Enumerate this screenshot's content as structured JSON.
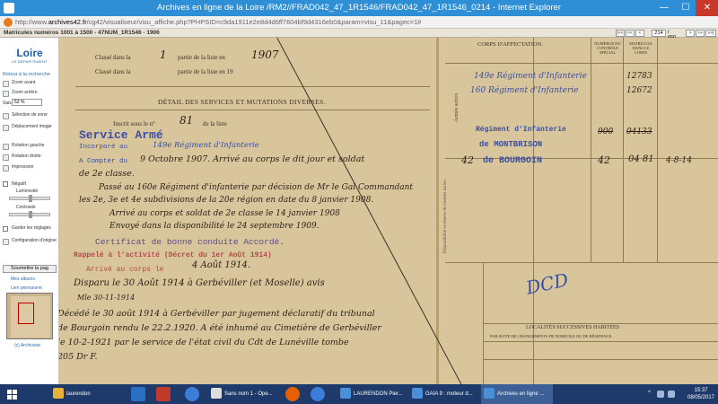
{
  "window": {
    "title": "Archives en ligne de la Loire /RM2//FRAD042_47_1R1546/FRAD042_47_1R1546_0214 - Internet Explorer",
    "minimize_glyph": "—",
    "maximize_glyph": "☐",
    "close_glyph": "✕"
  },
  "address": {
    "url_prefix": "http://www.",
    "url_host": "archives42.fr",
    "url_rest": "/cg42/visualiseur/visu_affiche.php?PHPSID=c9da1911e2e8d4d6ff7604bf9d4316eb0&param=visu_11&pagec=1#"
  },
  "viewer": {
    "doc_title": "Matricules numéros 1001 à 1500 - 47NUM_1R1546 - 1906",
    "pager": {
      "first": "|<<",
      "prev10": "<<",
      "prev": "<",
      "current": "214",
      "total": "/ 660",
      "next": ">",
      "next10": ">>",
      "last": ">>|"
    }
  },
  "sidebar": {
    "logo_word": "Loire",
    "logo_sub": "LE DÉPARTEMENT",
    "back_link": "Retour à la recherche",
    "zoom_in": "Zoom avant",
    "zoom_out": "Zoom arrière",
    "zoom_label": "Saisir",
    "zoom_value": "53 %",
    "selection": "Sélection de zone",
    "move": "Déplacement image",
    "rotate_left": "Rotation gauche",
    "rotate_right": "Rotation droite",
    "print": "Impression",
    "negative": "Négatif",
    "brightness": "Luminosité",
    "contrast": "Contraste",
    "keep_settings": "Garder les réglages",
    "config": "Configuration d'origine",
    "submit": "Soumettre la pag",
    "my_albums": "Mes albums",
    "permalink": "Lien permanent",
    "copyright": "(c) Archivaire"
  },
  "document": {
    "class_line1_print": "Classé dans la",
    "class_line1_hand": "1",
    "class_line1_print2": "partie de la liste en",
    "class_line1_year": "1907",
    "class_line2_print": "Classé dans la",
    "class_line2_print2": "partie de la liste en 19",
    "section_title": "DÉTAIL DES SERVICES ET MUTATIONS DIVERSES.",
    "inscrit_print": "Inscrit sous le n°",
    "inscrit_num": "81",
    "inscrit_print2": "de la liste",
    "service_stamp": "Service Armé",
    "incorpore": "Incorporé  au",
    "incorpore_regt": "149e Régiment d'Infanterie",
    "compter": "A Compter du",
    "compter_hand": "9 Octobre  1907.  Arrivé au corps le dit jour et soldat",
    "hand_2": "de 2e  classe.",
    "hand_3": "Passé au 160e Régiment d'infanterie par décision de Mr le Gal Commandant",
    "hand_4": "les 2e, 3e et 4e subdivisions de la 20e région en date du 8 janvier 1908.",
    "hand_5": "Arrivé au corps et soldat de 2e classe le 14 janvier 1908",
    "hand_6": "Envoyé dans la disponibilité le 24 septembre 1909.",
    "certificat": "Certificat de bonne conduite  Accordé.",
    "rappele": "Rappelé à l'activité (Décret du 1er Août 1914)",
    "arrive_print": "Arrivé au corps le",
    "arrive_hand": "4 Août 1914.",
    "disparu": "Disparu le 30 Août 1914 à Gerbéviller (et Moselle) avis",
    "disparu2": "Mle 30-11-1914",
    "decede": "Décédé le 30 août 1914 à Gerbéviller par jugement déclaratif du tribunal",
    "decede2": "de Bourgoin rendu le 22.2.1920.  A été inhumé au Cimetière de Gerbéviller",
    "decede3": "le 10-2-1921 par le service de l'état civil du Cdt de Lunéville tombe",
    "decede4": "205  Dr F.",
    "corps_header": "CORPS D'AFFECTATION.",
    "num_header": "NUMÉROS DU CONTRÔLE SPÉCIAL",
    "matricule_header": "MATRICULE DANS LE CORPS",
    "regt1": "149e Régiment d'Infanterie",
    "regt1_num": "12783",
    "regt2": "160 Régiment d'Infanterie",
    "regt2_num": "12672",
    "armee_label": "Armée active.",
    "regt3": "Régiment d'Infanterie",
    "regt3_num": "900",
    "regt3_mat": "04133",
    "montbrison": "de MONTBRISON",
    "bourgoin": "de   BOURGOIN",
    "bourgoin_prefix": "42",
    "bourgoin_num": "42",
    "bourgoin_mat": "04 81",
    "bourgoin_year": "4-8-14",
    "dispo_label": "Disponibilité et réserve de l'armée active.",
    "localites_header": "LOCALITÉS SUCCESSIVES HABITÉES",
    "localites_sub": "PAR SUITE DE CHANGEMENTS DE DOMICILE OU DE RÉSIDENCE.",
    "ink_mark": "DCD"
  },
  "taskbar": {
    "apps": [
      {
        "label": "laurendon"
      },
      {
        "label": "Sans nom 1 - Ope..."
      },
      {
        "label": "LAURENDON Pier..."
      },
      {
        "label": "GAIA 9 : moteur d..."
      },
      {
        "label": "Archives en ligne ..."
      }
    ],
    "time": "15:37",
    "date": "08/05/2017",
    "tray_chev": "^"
  },
  "colors": {
    "titlebar": "#2e8fd6",
    "taskbar": "#1d3a6b",
    "paper": "#d8c59b",
    "stamp_blue": "#3a4fa5",
    "stamp_red": "#b24a4a",
    "ink_dark": "#2a1f16"
  }
}
